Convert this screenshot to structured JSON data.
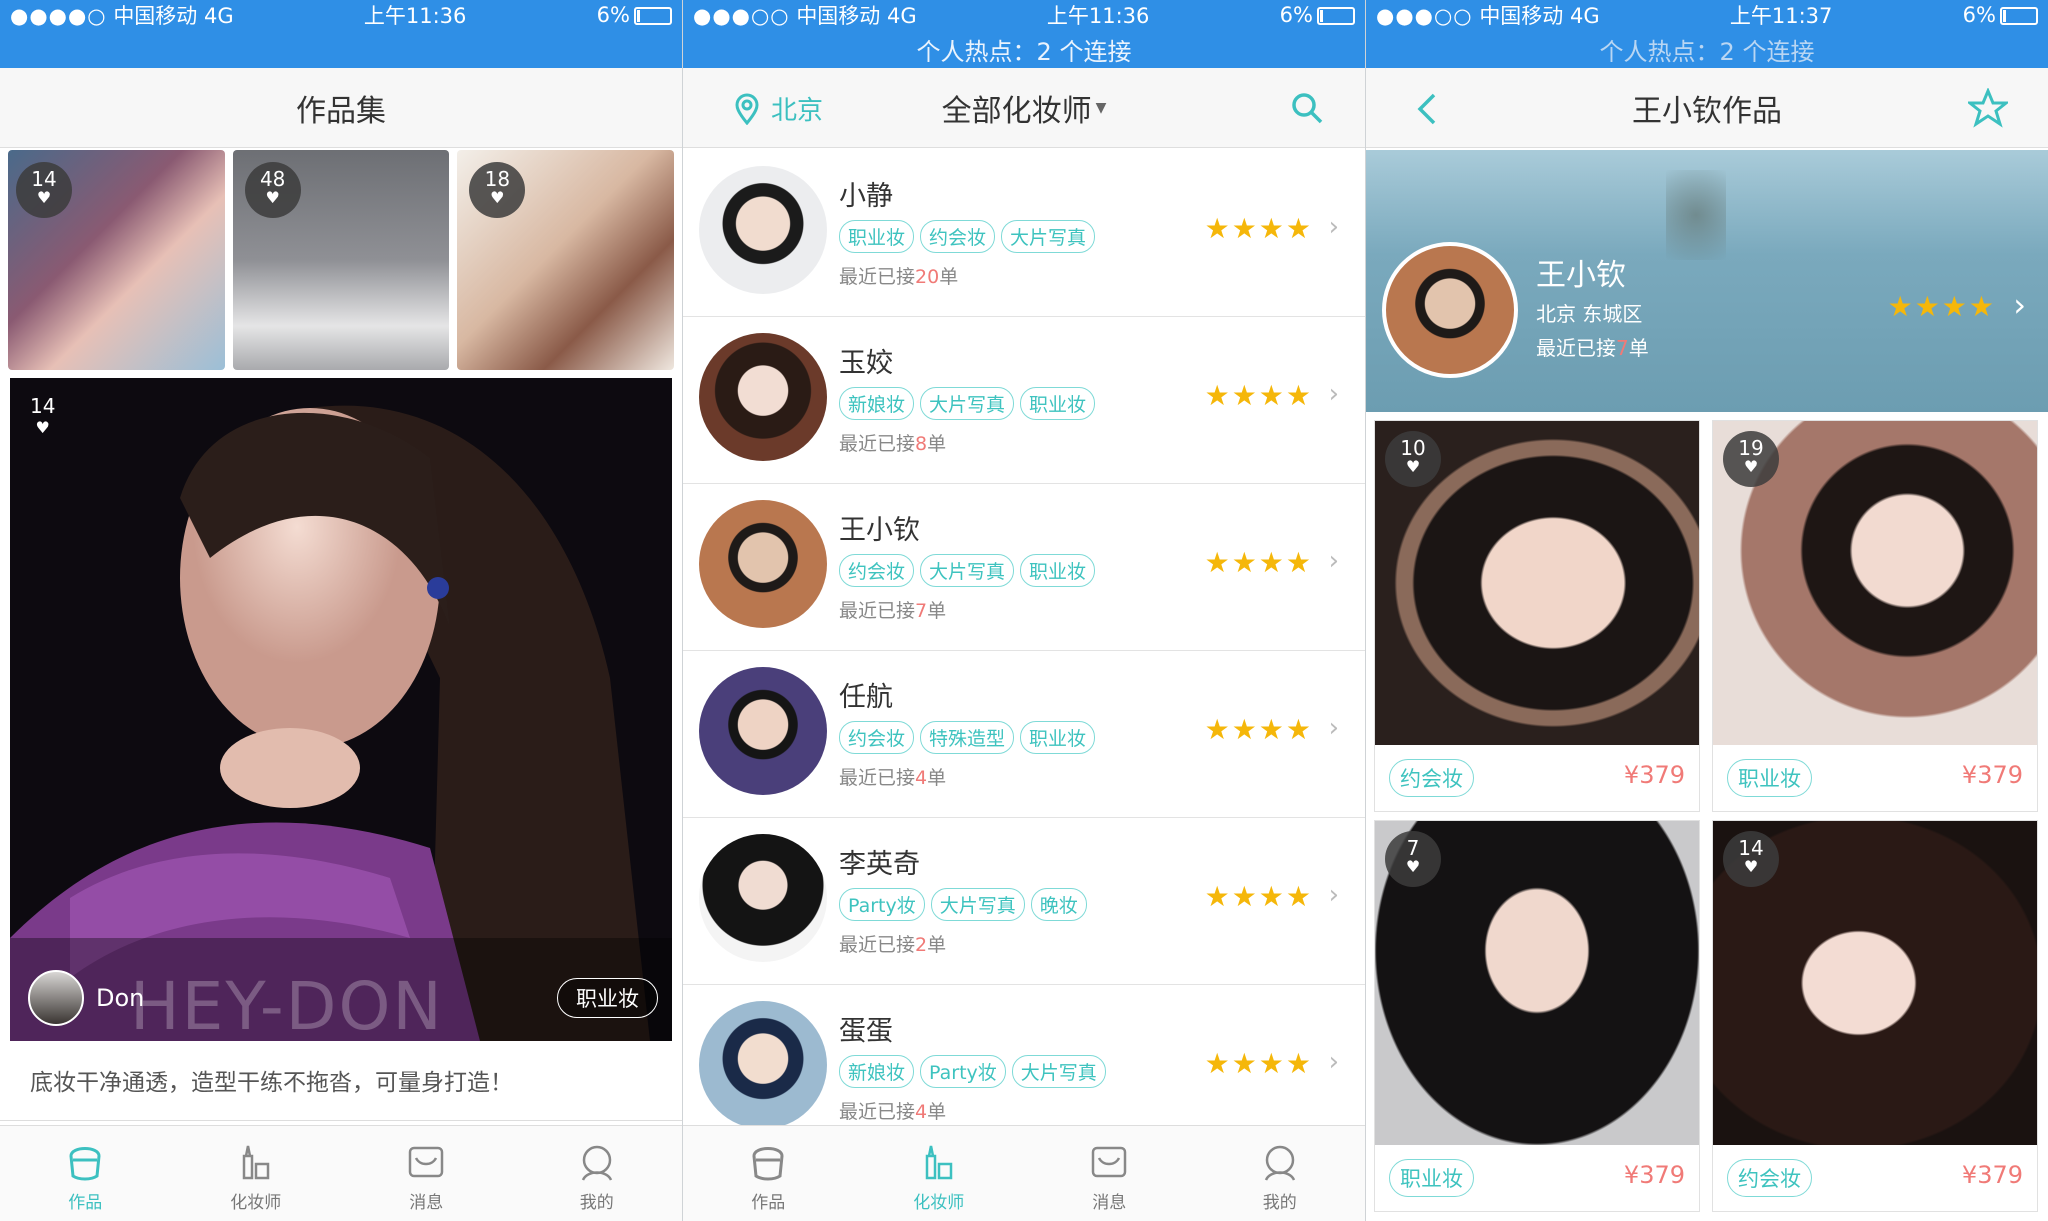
{
  "status_bars": [
    {
      "carrier": "中国移动",
      "net": "4G",
      "time": "上午11:36",
      "battery": "6%",
      "hotspot": ""
    },
    {
      "carrier": "中国移动",
      "net": "4G",
      "time": "上午11:36",
      "battery": "6%",
      "hotspot": "个人热点：2 个连接"
    },
    {
      "carrier": "中国移动",
      "net": "4G",
      "time": "上午11:37",
      "battery": "6%",
      "hotspot": "个人热点：2 个连接"
    }
  ],
  "portfolio": {
    "title": "作品集",
    "thumbs": [
      {
        "likes": "14"
      },
      {
        "likes": "48"
      },
      {
        "likes": "18"
      }
    ],
    "hero": {
      "likes": "14",
      "author": "Don",
      "tag": "职业妆",
      "watermark": "HEY-DON"
    },
    "description": "底妆干净通透，造型干练不拖沓，可量身打造！"
  },
  "artists_page": {
    "city": "北京",
    "filter": "全部化妆师",
    "artists": [
      {
        "name": "小静",
        "tags": [
          "职业妆",
          "约会妆",
          "大片写真"
        ],
        "orders_prefix": "最近已接",
        "orders": "20",
        "orders_suffix": "单",
        "stars": "★★★★"
      },
      {
        "name": "玉姣",
        "tags": [
          "新娘妆",
          "大片写真",
          "职业妆"
        ],
        "orders_prefix": "最近已接",
        "orders": "8",
        "orders_suffix": "单",
        "stars": "★★★★"
      },
      {
        "name": "王小钦",
        "tags": [
          "约会妆",
          "大片写真",
          "职业妆"
        ],
        "orders_prefix": "最近已接",
        "orders": "7",
        "orders_suffix": "单",
        "stars": "★★★★"
      },
      {
        "name": "任航",
        "tags": [
          "约会妆",
          "特殊造型",
          "职业妆"
        ],
        "orders_prefix": "最近已接",
        "orders": "4",
        "orders_suffix": "单",
        "stars": "★★★★"
      },
      {
        "name": "李英奇",
        "tags": [
          "Party妆",
          "大片写真",
          "晚妆"
        ],
        "orders_prefix": "最近已接",
        "orders": "2",
        "orders_suffix": "单",
        "stars": "★★★★"
      },
      {
        "name": "蛋蛋",
        "tags": [
          "新娘妆",
          "Party妆",
          "大片写真"
        ],
        "orders_prefix": "最近已接",
        "orders": "4",
        "orders_suffix": "单",
        "stars": "★★★★"
      }
    ]
  },
  "works_page": {
    "title": "王小钦作品",
    "artist": {
      "name": "王小钦",
      "location": "北京 东城区",
      "orders_prefix": "最近已接",
      "orders": "7",
      "orders_suffix": "单",
      "stars": "★★★★"
    },
    "works": [
      {
        "likes": "10",
        "tag": "约会妆",
        "price": "¥379"
      },
      {
        "likes": "19",
        "tag": "职业妆",
        "price": "¥379"
      },
      {
        "likes": "7",
        "tag": "职业妆",
        "price": "¥379"
      },
      {
        "likes": "14",
        "tag": "约会妆",
        "price": "¥379"
      }
    ]
  },
  "tabbar": {
    "tabs": [
      "作品",
      "化妆师",
      "消息",
      "我的"
    ]
  },
  "colors": {
    "status": "#2f8fe6",
    "accent": "#3cc0c0",
    "price": "#f07a77",
    "star": "#f5b70a"
  }
}
